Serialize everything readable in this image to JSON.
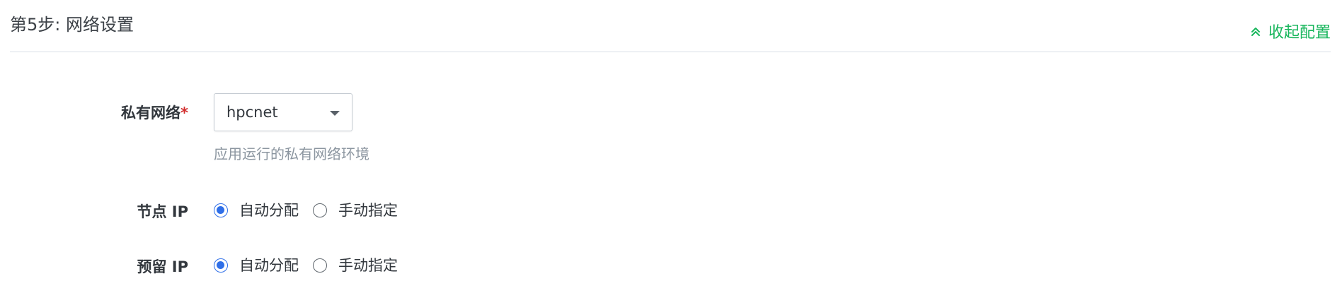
{
  "section": {
    "title": "第5步: 网络设置",
    "collapse_label": "收起配置",
    "collapse_icon": "double-chevron-up-icon",
    "accent_color": "#18b65c"
  },
  "private_network": {
    "label": "私有网络",
    "required_mark": "*",
    "selected_value": "hpcnet",
    "help_text": "应用运行的私有网络环境"
  },
  "node_ip": {
    "label": "节点 IP",
    "options": [
      {
        "label": "自动分配",
        "checked": true
      },
      {
        "label": "手动指定",
        "checked": false
      }
    ]
  },
  "reserved_ip": {
    "label": "预留 IP",
    "options": [
      {
        "label": "自动分配",
        "checked": true
      },
      {
        "label": "手动指定",
        "checked": false
      }
    ]
  },
  "colors": {
    "radio_checked": "#2f6fe8",
    "required": "#d22d2d",
    "help_text": "#8c96a0"
  }
}
